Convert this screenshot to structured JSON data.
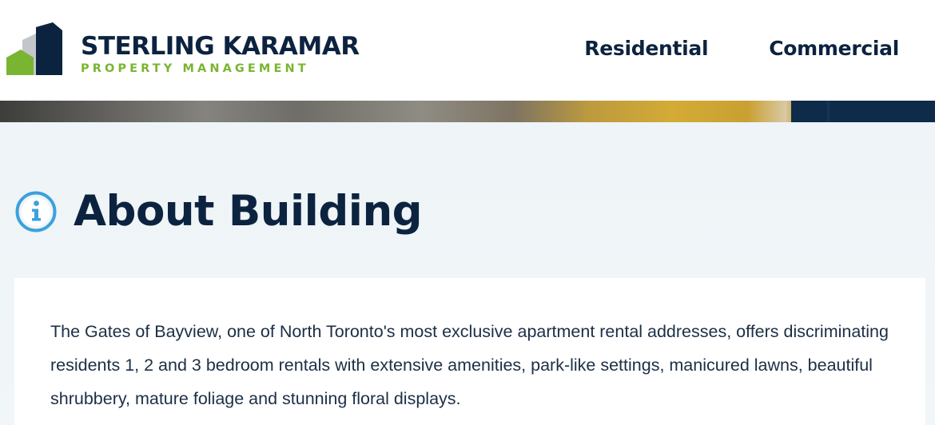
{
  "header": {
    "logo": {
      "name": "STERLING KARAMAR",
      "subtitle": "PROPERTY MANAGEMENT"
    },
    "nav": [
      {
        "label": "Residential"
      },
      {
        "label": "Commercial"
      }
    ]
  },
  "about": {
    "icon": "info-circle-icon",
    "title": "About Building",
    "description": "The Gates of Bayview, one of North Toronto's most exclusive apartment rental addresses, offers discriminating residents 1, 2 and 3 bedroom rentals with extensive amenities, park-like settings, manicured lawns, beautiful shrubbery, mature foliage and stunning floral displays."
  },
  "colors": {
    "navy": "#0c2340",
    "green": "#7ab532",
    "info_blue": "#3da0dd",
    "section_bg": "#eef4f7"
  }
}
